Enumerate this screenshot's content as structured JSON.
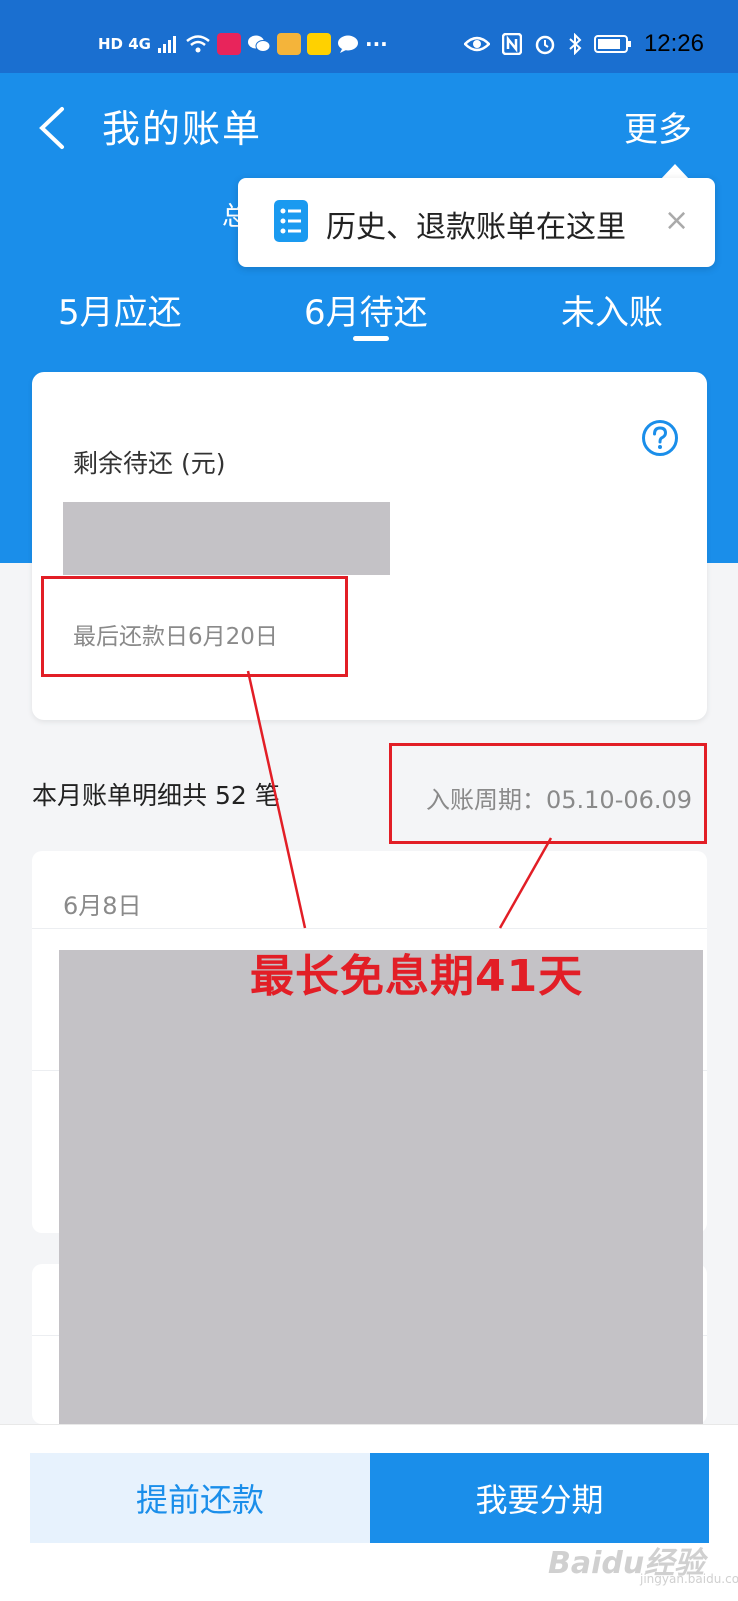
{
  "status_bar": {
    "left_label": "HD 4G",
    "time": "12:26",
    "dots": "···"
  },
  "header": {
    "title": "我的账单",
    "more": "更多",
    "hidden_char": "总"
  },
  "tooltip": {
    "text": "历史、退款账单在这里",
    "close": "×"
  },
  "tabs": [
    {
      "label": "5月应还"
    },
    {
      "label": "6月待还"
    },
    {
      "label": "未入账"
    }
  ],
  "card": {
    "remain_label": "剩余待还 (元)",
    "due_date": "最后还款日6月20日"
  },
  "summary": {
    "count_text": "本月账单明细共 52 笔",
    "period_text": "入账周期：05.10-06.09"
  },
  "detail": {
    "date_label": "6月8日"
  },
  "bottom": {
    "prepay": "提前还款",
    "installment": "我要分期"
  },
  "annotation": {
    "text": "最长免息期41天",
    "color": "#e21e26"
  },
  "watermark": {
    "text": "Baidu经验",
    "sub": "jingyan.baidu.com"
  },
  "colors": {
    "brand": "#1a8eea",
    "status_bar": "#1a6fd0"
  }
}
